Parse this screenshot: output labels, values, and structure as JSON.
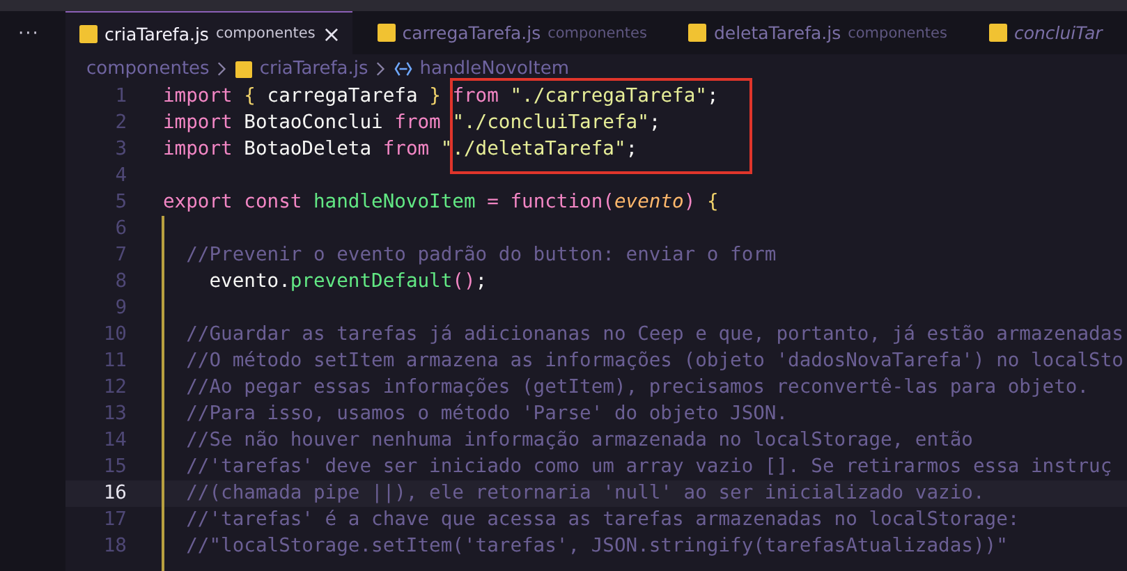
{
  "activity_bar": {
    "more": "···"
  },
  "tabs": [
    {
      "name": "criaTarefa.js",
      "folder": "componentes",
      "selected": true,
      "preview": false,
      "close": "×"
    },
    {
      "name": "carregaTarefa.js",
      "folder": "componentes",
      "selected": false,
      "preview": false
    },
    {
      "name": "deletaTarefa.js",
      "folder": "componentes",
      "selected": false,
      "preview": false
    },
    {
      "name": "concluiTar",
      "selected": false,
      "preview": true
    }
  ],
  "breadcrumb": [
    {
      "kind": "folder",
      "label": "componentes"
    },
    {
      "kind": "file",
      "label": "criaTarefa.js"
    },
    {
      "kind": "symbol",
      "label": "handleNovoItem"
    }
  ],
  "editor": {
    "lines": [
      {
        "number": "1",
        "current": false,
        "tokens": [
          {
            "kind": "keyword",
            "text": "import "
          },
          {
            "kind": "brace",
            "text": "{"
          },
          {
            "kind": "plain",
            "text": " carregaTarefa "
          },
          {
            "kind": "brace",
            "text": "}"
          },
          {
            "kind": "keyword",
            "text": " from "
          },
          {
            "kind": "string",
            "text": "\"./carregaTarefa\""
          },
          {
            "kind": "plain",
            "text": ";"
          }
        ]
      },
      {
        "number": "2",
        "current": false,
        "tokens": [
          {
            "kind": "keyword",
            "text": "import"
          },
          {
            "kind": "plain",
            "text": " BotaoConclui "
          },
          {
            "kind": "keyword",
            "text": "from "
          },
          {
            "kind": "string",
            "text": "\"./concluiTarefa\""
          },
          {
            "kind": "plain",
            "text": ";"
          }
        ]
      },
      {
        "number": "3",
        "current": false,
        "tokens": [
          {
            "kind": "keyword",
            "text": "import"
          },
          {
            "kind": "plain",
            "text": " BotaoDeleta "
          },
          {
            "kind": "keyword",
            "text": "from "
          },
          {
            "kind": "string",
            "text": "\"./deletaTarefa\""
          },
          {
            "kind": "plain",
            "text": ";"
          }
        ]
      },
      {
        "number": "4",
        "current": false
      },
      {
        "number": "5",
        "current": false,
        "tokens": [
          {
            "kind": "keyword",
            "text": "export const "
          },
          {
            "kind": "function",
            "text": "handleNovoItem"
          },
          {
            "kind": "keyword",
            "text": " = function("
          },
          {
            "kind": "param",
            "text": "evento"
          },
          {
            "kind": "keyword",
            "text": ") "
          },
          {
            "kind": "brace",
            "text": "{"
          }
        ]
      },
      {
        "number": "6",
        "current": false
      },
      {
        "number": "7",
        "current": false,
        "tokens": [
          {
            "kind": "comment",
            "text": "  //Prevenir o evento padrão do button: enviar o form"
          }
        ]
      },
      {
        "number": "8",
        "current": false,
        "tokens": [
          {
            "kind": "plain",
            "text": "    evento."
          },
          {
            "kind": "function",
            "text": "preventDefault"
          },
          {
            "kind": "keyword",
            "text": "()"
          },
          {
            "kind": "plain",
            "text": ";"
          }
        ]
      },
      {
        "number": "9",
        "current": false
      },
      {
        "number": "10",
        "current": false,
        "tokens": [
          {
            "kind": "comment",
            "text": "  //Guardar as tarefas já adicionanas no Ceep e que, portanto, já estão armazenadas"
          }
        ]
      },
      {
        "number": "11",
        "current": false,
        "tokens": [
          {
            "kind": "comment",
            "text": "  //O método setItem armazena as informações (objeto 'dadosNovaTarefa') no localSto"
          }
        ]
      },
      {
        "number": "12",
        "current": false,
        "tokens": [
          {
            "kind": "comment",
            "text": "  //Ao pegar essas informações (getItem), precisamos reconvertê-las para objeto."
          }
        ]
      },
      {
        "number": "13",
        "current": false,
        "tokens": [
          {
            "kind": "comment",
            "text": "  //Para isso, usamos o método 'Parse' do objeto JSON."
          }
        ]
      },
      {
        "number": "14",
        "current": false,
        "tokens": [
          {
            "kind": "comment",
            "text": "  //Se não houver nenhuma informação armazenada no localStorage, então"
          }
        ]
      },
      {
        "number": "15",
        "current": false,
        "tokens": [
          {
            "kind": "comment",
            "text": "  //'tarefas' deve ser iniciado como um array vazio []. Se retirarmos essa instruç"
          }
        ]
      },
      {
        "number": "16",
        "current": true,
        "tokens": [
          {
            "kind": "comment",
            "text": "  //(chamada pipe ||), ele retornaria 'null' ao ser inicializado vazio."
          }
        ]
      },
      {
        "number": "17",
        "current": false,
        "tokens": [
          {
            "kind": "comment",
            "text": "  //'tarefas' é a chave que acessa as tarefas armazenadas no localStorage:"
          }
        ]
      },
      {
        "number": "18",
        "current": false,
        "tokens": [
          {
            "kind": "comment",
            "text": "  //\"localStorage.setItem('tarefas', JSON.stringify(tarefasAtualizadas))\""
          }
        ]
      }
    ]
  }
}
